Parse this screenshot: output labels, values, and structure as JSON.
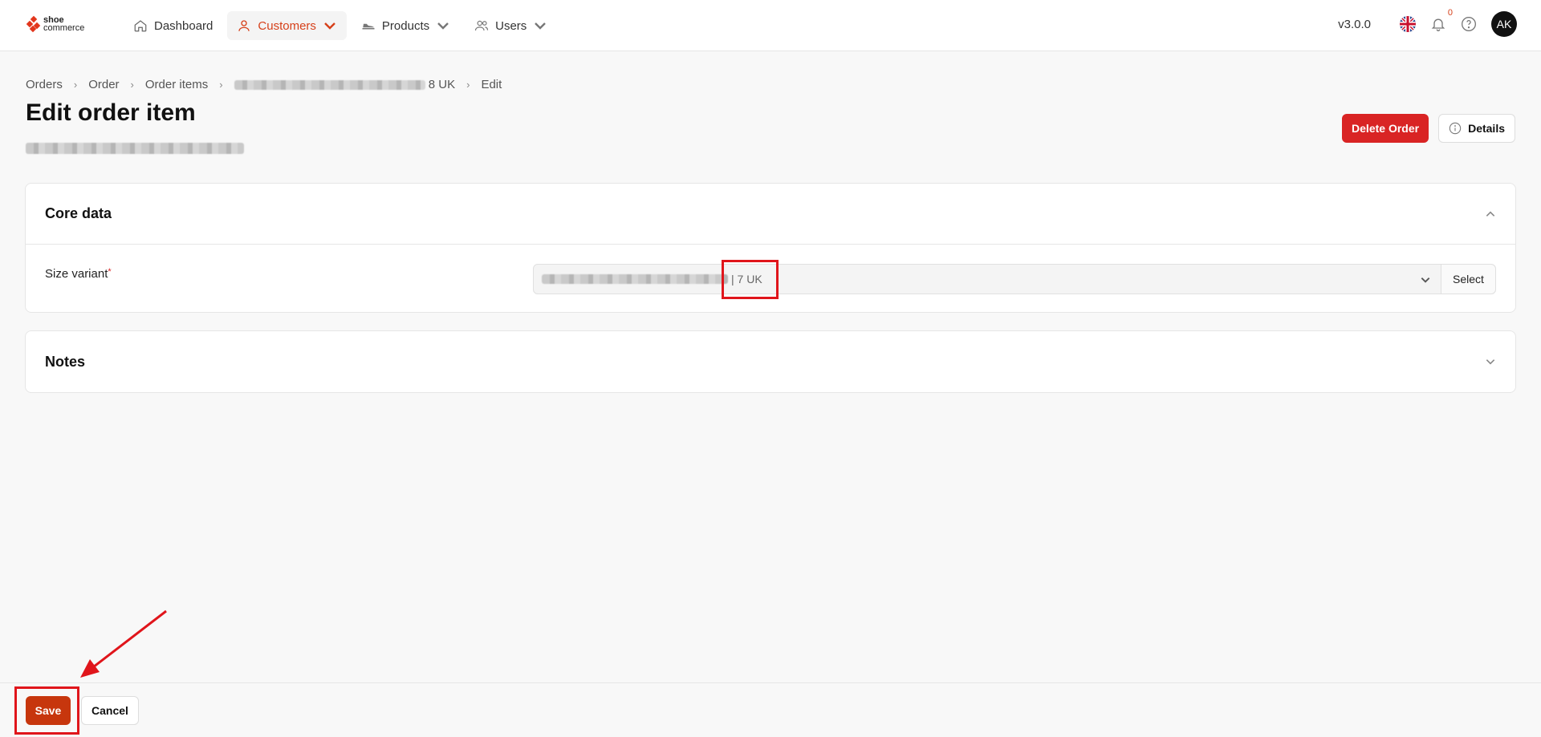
{
  "brand": {
    "line1": "shoe",
    "line2": "commerce"
  },
  "nav": {
    "items": [
      {
        "label": "Dashboard",
        "icon": "home-icon"
      },
      {
        "label": "Customers",
        "icon": "user-icon"
      },
      {
        "label": "Products",
        "icon": "shoe-icon"
      },
      {
        "label": "Users",
        "icon": "users-icon"
      }
    ]
  },
  "header": {
    "version": "v3.0.0",
    "notifications": "0",
    "avatar": "AK"
  },
  "breadcrumb": {
    "items": [
      "Orders",
      "Order",
      "Order items",
      "8 UK",
      "Edit"
    ]
  },
  "page": {
    "title": "Edit order item"
  },
  "actions": {
    "delete": "Delete Order",
    "details": "Details"
  },
  "core": {
    "title": "Core data",
    "size_label": "Size variant",
    "required_mark": "*",
    "size_value_suffix": "| 7 UK",
    "select_button": "Select"
  },
  "notes": {
    "title": "Notes"
  },
  "footer": {
    "save": "Save",
    "cancel": "Cancel"
  },
  "colors": {
    "accent": "#d6401a",
    "danger": "#d92424",
    "save": "#c7360d",
    "annotation": "#e0151b"
  }
}
